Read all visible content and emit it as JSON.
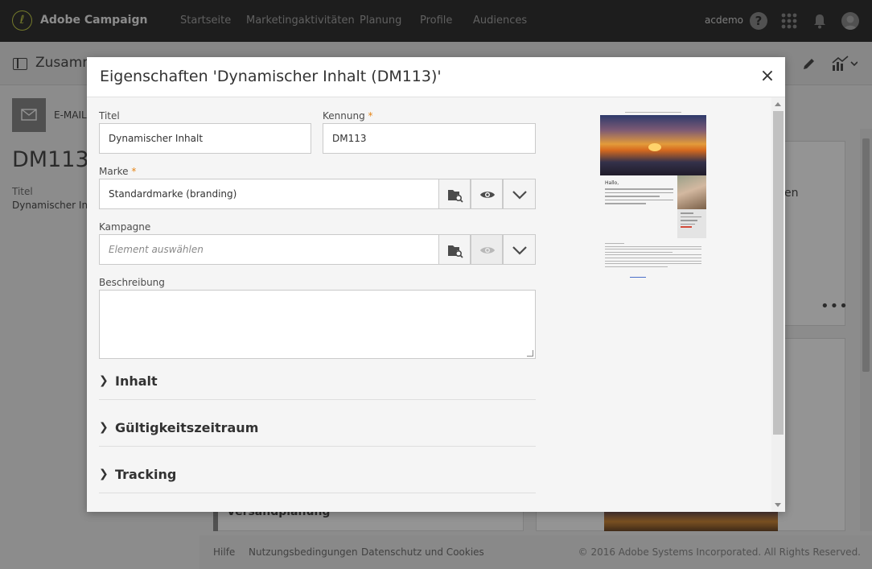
{
  "app": {
    "name": "Adobe Campaign",
    "user": "acdemo"
  },
  "nav": {
    "items": [
      "Startseite",
      "Marketingaktivitäten",
      "Planung",
      "Profile",
      "Audiences"
    ],
    "help": "?"
  },
  "background": {
    "subbar_title": "Zusamm",
    "email_tag": "E-MAIL",
    "dm_title": "DM113",
    "title_label": "Titel",
    "title_value": "Dynamischer Inha",
    "card_snippet": "en",
    "more": "•••",
    "section_label": "Versandplanung"
  },
  "footer": {
    "help": "Hilfe",
    "terms": "Nutzungsbedingungen",
    "privacy": "Datenschutz und Cookies",
    "copyright": "© 2016 Adobe Systems Incorporated. All Rights Reserved."
  },
  "modal": {
    "title": "Eigenschaften 'Dynamischer Inhalt (DM113)'",
    "close": "×",
    "fields": {
      "titel_label": "Titel",
      "titel_value": "Dynamischer Inhalt",
      "kennung_label": "Kennung",
      "kennung_value": "DM113",
      "marke_label": "Marke",
      "marke_value": "Standardmarke (branding)",
      "kampagne_label": "Kampagne",
      "kampagne_placeholder": "Element auswählen",
      "beschreibung_label": "Beschreibung",
      "required_mark": "*"
    },
    "sections": [
      "Inhalt",
      "Gültigkeitszeitraum",
      "Tracking"
    ],
    "preview": {
      "greeting": "Hallo,"
    }
  },
  "colors": {
    "topbar": "#323232",
    "required": "#e68619",
    "logo": "#c8d14a"
  }
}
